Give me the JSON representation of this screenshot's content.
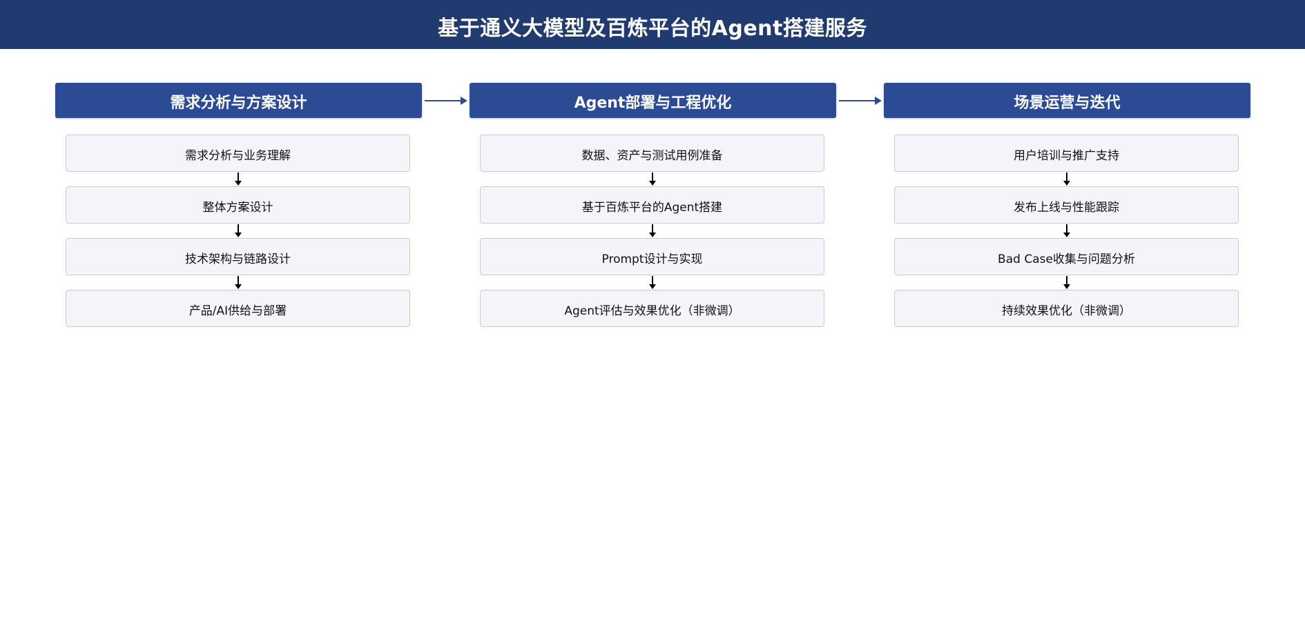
{
  "header": {
    "title": "基于通义大模型及百炼平台的Agent搭建服务"
  },
  "phases": [
    {
      "title": "需求分析与方案设计",
      "steps": [
        "需求分析与业务理解",
        "整体方案设计",
        "技术架构与链路设计",
        "产品/AI供给与部署"
      ]
    },
    {
      "title": "Agent部署与工程优化",
      "steps": [
        "数据、资产与测试用例准备",
        "基于百炼平台的Agent搭建",
        "Prompt设计与实现",
        "Agent评估与效果优化（非微调）"
      ]
    },
    {
      "title": "场景运营与迭代",
      "steps": [
        "用户培训与推广支持",
        "发布上线与性能跟踪",
        "Bad Case收集与问题分析",
        "持续效果优化（非微调）"
      ]
    }
  ],
  "colors": {
    "header_bg": "#213a6f",
    "phase_bg": "#2b4b94",
    "step_bg": "#f4f4f9",
    "step_border": "#c9c9d6"
  }
}
